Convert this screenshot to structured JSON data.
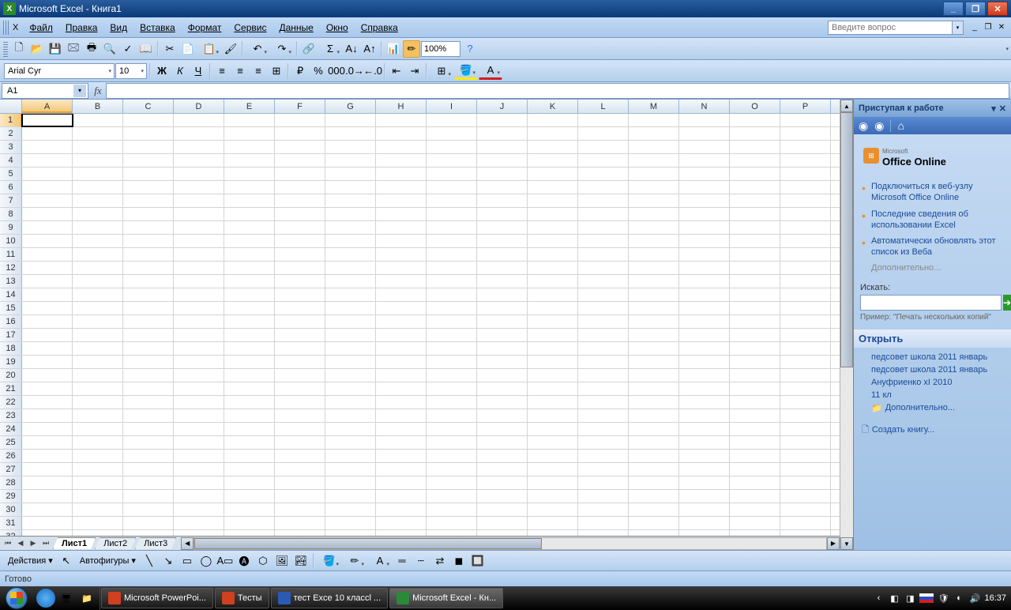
{
  "titlebar": {
    "app": "Microsoft Excel",
    "doc": "Книга1"
  },
  "menu": {
    "file": "Файл",
    "edit": "Правка",
    "view": "Вид",
    "insert": "Вставка",
    "format": "Формат",
    "tools": "Сервис",
    "data": "Данные",
    "window": "Окно",
    "help": "Справка",
    "question_placeholder": "Введите вопрос"
  },
  "toolbar": {
    "zoom": "100%"
  },
  "font": {
    "name": "Arial Cyr",
    "size": "10"
  },
  "namebox": "A1",
  "columns": [
    "A",
    "B",
    "C",
    "D",
    "E",
    "F",
    "G",
    "H",
    "I",
    "J",
    "K",
    "L",
    "M",
    "N",
    "O",
    "P"
  ],
  "rows_count": 32,
  "sheets": {
    "s1": "Лист1",
    "s2": "Лист2",
    "s3": "Лист3"
  },
  "taskpane": {
    "title": "Приступая к работе",
    "office": "Office Online",
    "office_pre": "Microsoft",
    "link1": "Подключиться к веб-узлу Microsoft Office Online",
    "link2": "Последние сведения об использовании Excel",
    "link3": "Автоматически обновлять этот список из Веба",
    "more": "Дополнительно...",
    "search_label": "Искать:",
    "example": "Пример: \"Печать нескольких копий\"",
    "open": "Открыть",
    "f1": "педсовет школа 2011 январь",
    "f2": "педсовет школа 2011 январь",
    "f3": "Ануфриенко xI 2010",
    "f4": "11 кл",
    "fmore": "Дополнительно...",
    "create": "Создать книгу..."
  },
  "drawbar": {
    "actions": "Действия",
    "autoshapes": "Автофигуры"
  },
  "status": "Готово",
  "taskbar": {
    "pp": "Microsoft PowerPoi...",
    "tests": "Тесты",
    "testdoc": "тест Exce 10 классl ...",
    "excel": "Microsoft Excel - Кн...",
    "clock": "16:37"
  }
}
